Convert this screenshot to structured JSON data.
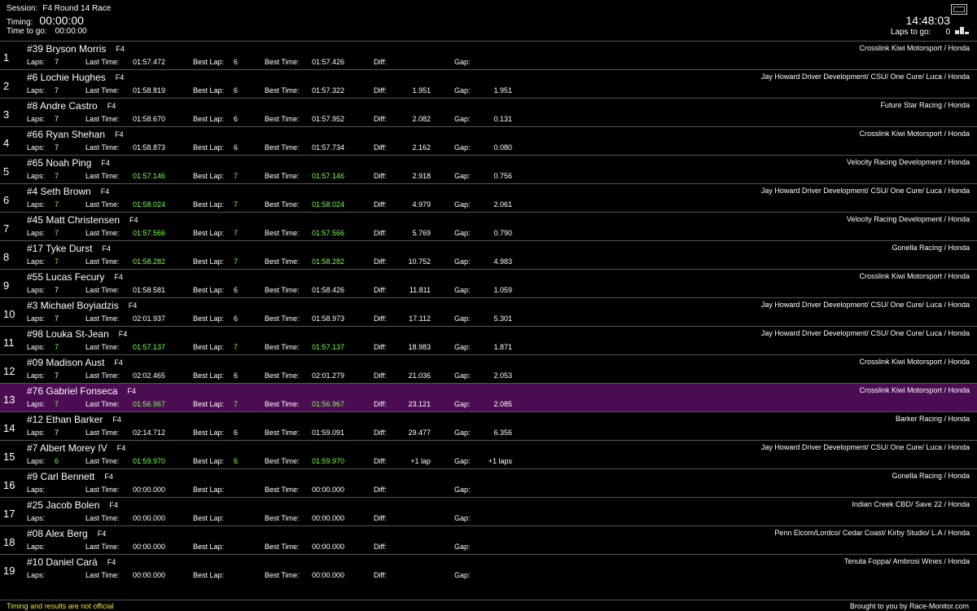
{
  "header": {
    "session_label": "Session:",
    "session_value": "F4 Round 14 Race",
    "timing_label": "Timing:",
    "timing_value": "00:00:00",
    "time_to_go_label": "Time to go:",
    "time_to_go_value": "00:00:00",
    "clock": "14:48:03",
    "laps_to_go_label": "Laps to go:",
    "laps_to_go_value": "0",
    "icons": [
      "fullscreen-icon",
      "podium-icon"
    ]
  },
  "field_labels": {
    "laps": "Laps:",
    "last_time": "Last Time:",
    "best_lap": "Best Lap:",
    "best_time": "Best Time:",
    "diff": "Diff:",
    "gap": "Gap:"
  },
  "colors": {
    "highlight_row": "#4b0c52",
    "personal_best": "#7cff4f",
    "disclaimer": "#e8e04a"
  },
  "rows": [
    {
      "pos": "1",
      "driver": "#39 Bryson Morris",
      "cls": "F4",
      "team": "Crosslink Kiwi Motorsport / Honda",
      "laps": "7",
      "last": "01:57.472",
      "best_lap": "6",
      "best_time": "01:57.426",
      "diff": "",
      "gap": "",
      "green": false,
      "highlight": false
    },
    {
      "pos": "2",
      "driver": "#6 Lochie Hughes",
      "cls": "F4",
      "team": "Jay Howard Driver Development/ CSU/ One Cure/ Luca / Honda",
      "laps": "7",
      "last": "01:58.819",
      "best_lap": "6",
      "best_time": "01:57.322",
      "diff": "1.951",
      "gap": "1.951",
      "green": false,
      "highlight": false
    },
    {
      "pos": "3",
      "driver": "#8 Andre Castro",
      "cls": "F4",
      "team": "Future Star Racing / Honda",
      "laps": "7",
      "last": "01:58.670",
      "best_lap": "6",
      "best_time": "01:57.952",
      "diff": "2.082",
      "gap": "0.131",
      "green": false,
      "highlight": false
    },
    {
      "pos": "4",
      "driver": "#66 Ryan Shehan",
      "cls": "F4",
      "team": "Crosslink Kiwi Motorsport / Honda",
      "laps": "7",
      "last": "01:58.873",
      "best_lap": "6",
      "best_time": "01:57.734",
      "diff": "2.162",
      "gap": "0.080",
      "green": false,
      "highlight": false
    },
    {
      "pos": "5",
      "driver": "#65 Noah Ping",
      "cls": "F4",
      "team": "Velocity Racing Development / Honda",
      "laps": "7",
      "last": "01:57.146",
      "best_lap": "7",
      "best_time": "01:57.146",
      "diff": "2.918",
      "gap": "0.756",
      "green": true,
      "highlight": false
    },
    {
      "pos": "6",
      "driver": "#4 Seth Brown",
      "cls": "F4",
      "team": "Jay Howard Driver Development/ CSU/ One Cure/ Luca / Honda",
      "laps": "7",
      "last": "01:58.024",
      "best_lap": "7",
      "best_time": "01:58.024",
      "diff": "4.979",
      "gap": "2.061",
      "green": true,
      "highlight": false
    },
    {
      "pos": "7",
      "driver": "#45 Matt Christensen",
      "cls": "F4",
      "team": "Velocity Racing Development / Honda",
      "laps": "7",
      "last": "01:57.566",
      "best_lap": "7",
      "best_time": "01:57.566",
      "diff": "5.769",
      "gap": "0.790",
      "green": true,
      "highlight": false
    },
    {
      "pos": "8",
      "driver": "#17 Tyke Durst",
      "cls": "F4",
      "team": "Gonella Racing / Honda",
      "laps": "7",
      "last": "01:58.282",
      "best_lap": "7",
      "best_time": "01:58.282",
      "diff": "10.752",
      "gap": "4.983",
      "green": true,
      "highlight": false
    },
    {
      "pos": "9",
      "driver": "#55 Lucas Fecury",
      "cls": "F4",
      "team": "Crosslink Kiwi Motorsport / Honda",
      "laps": "7",
      "last": "01:58.581",
      "best_lap": "6",
      "best_time": "01:58.426",
      "diff": "11.811",
      "gap": "1.059",
      "green": false,
      "highlight": false
    },
    {
      "pos": "10",
      "driver": "#3 Michael Boyiadzis",
      "cls": "F4",
      "team": "Jay Howard Driver Development/ CSU/ One Cure/ Luca / Honda",
      "laps": "7",
      "last": "02:01.937",
      "best_lap": "6",
      "best_time": "01:58.973",
      "diff": "17.112",
      "gap": "5.301",
      "green": false,
      "highlight": false
    },
    {
      "pos": "11",
      "driver": "#98 Louka St-Jean",
      "cls": "F4",
      "team": "Jay Howard Driver Development/ CSU/ One Cure/ Luca / Honda",
      "laps": "7",
      "last": "01:57.137",
      "best_lap": "7",
      "best_time": "01:57.137",
      "diff": "18.983",
      "gap": "1.871",
      "green": true,
      "highlight": false
    },
    {
      "pos": "12",
      "driver": "#09 Madison Aust",
      "cls": "F4",
      "team": "Crosslink Kiwi Motorsport / Honda",
      "laps": "7",
      "last": "02:02.465",
      "best_lap": "6",
      "best_time": "02:01.279",
      "diff": "21.036",
      "gap": "2.053",
      "green": false,
      "highlight": false
    },
    {
      "pos": "13",
      "driver": "#76 Gabriel Fonseca",
      "cls": "F4",
      "team": "Crosslink Kiwi Motorsport / Honda",
      "laps": "7",
      "last": "01:56.967",
      "best_lap": "7",
      "best_time": "01:56.967",
      "diff": "23.121",
      "gap": "2.085",
      "green": true,
      "highlight": true
    },
    {
      "pos": "14",
      "driver": "#12 Ethan Barker",
      "cls": "F4",
      "team": "Barker Racing / Honda",
      "laps": "7",
      "last": "02:14.712",
      "best_lap": "6",
      "best_time": "01:59.091",
      "diff": "29.477",
      "gap": "6.356",
      "green": false,
      "highlight": false
    },
    {
      "pos": "15",
      "driver": "#7 Albert Morey IV",
      "cls": "F4",
      "team": "Jay Howard Driver Development/ CSU/ One Cure/ Luca / Honda",
      "laps": "6",
      "last": "01:59.970",
      "best_lap": "6",
      "best_time": "01:59.970",
      "diff": "+1 lap",
      "gap": "+1 laps",
      "green": true,
      "highlight": false
    },
    {
      "pos": "16",
      "driver": "#9 Carl Bennett",
      "cls": "F4",
      "team": "Gonella Racing / Honda",
      "laps": "",
      "last": "00:00.000",
      "best_lap": "",
      "best_time": "00:00.000",
      "diff": "",
      "gap": "",
      "green": false,
      "highlight": false
    },
    {
      "pos": "17",
      "driver": "#25 Jacob Bolen",
      "cls": "F4",
      "team": "Indian Creek CBD/ Save 22 / Honda",
      "laps": "",
      "last": "00:00.000",
      "best_lap": "",
      "best_time": "00:00.000",
      "diff": "",
      "gap": "",
      "green": false,
      "highlight": false
    },
    {
      "pos": "18",
      "driver": "#08 Alex Berg",
      "cls": "F4",
      "team": "Penn Elcom/Lordco/ Cedar Coast/ Kirby Studio/ L.A / Honda",
      "laps": "",
      "last": "00:00.000",
      "best_lap": "",
      "best_time": "00:00.000",
      "diff": "",
      "gap": "",
      "green": false,
      "highlight": false
    },
    {
      "pos": "19",
      "driver": "#10 Daniel Cará",
      "cls": "F4",
      "team": "Tenuta Foppa/ Ambrosi Wines / Honda",
      "laps": "",
      "last": "00:00.000",
      "best_lap": "",
      "best_time": "00:00.000",
      "diff": "",
      "gap": "",
      "green": false,
      "highlight": false
    }
  ],
  "footer": {
    "disclaimer": "Timing and results are not official",
    "brought_by": "Brought to you by Race-Monitor.com"
  }
}
